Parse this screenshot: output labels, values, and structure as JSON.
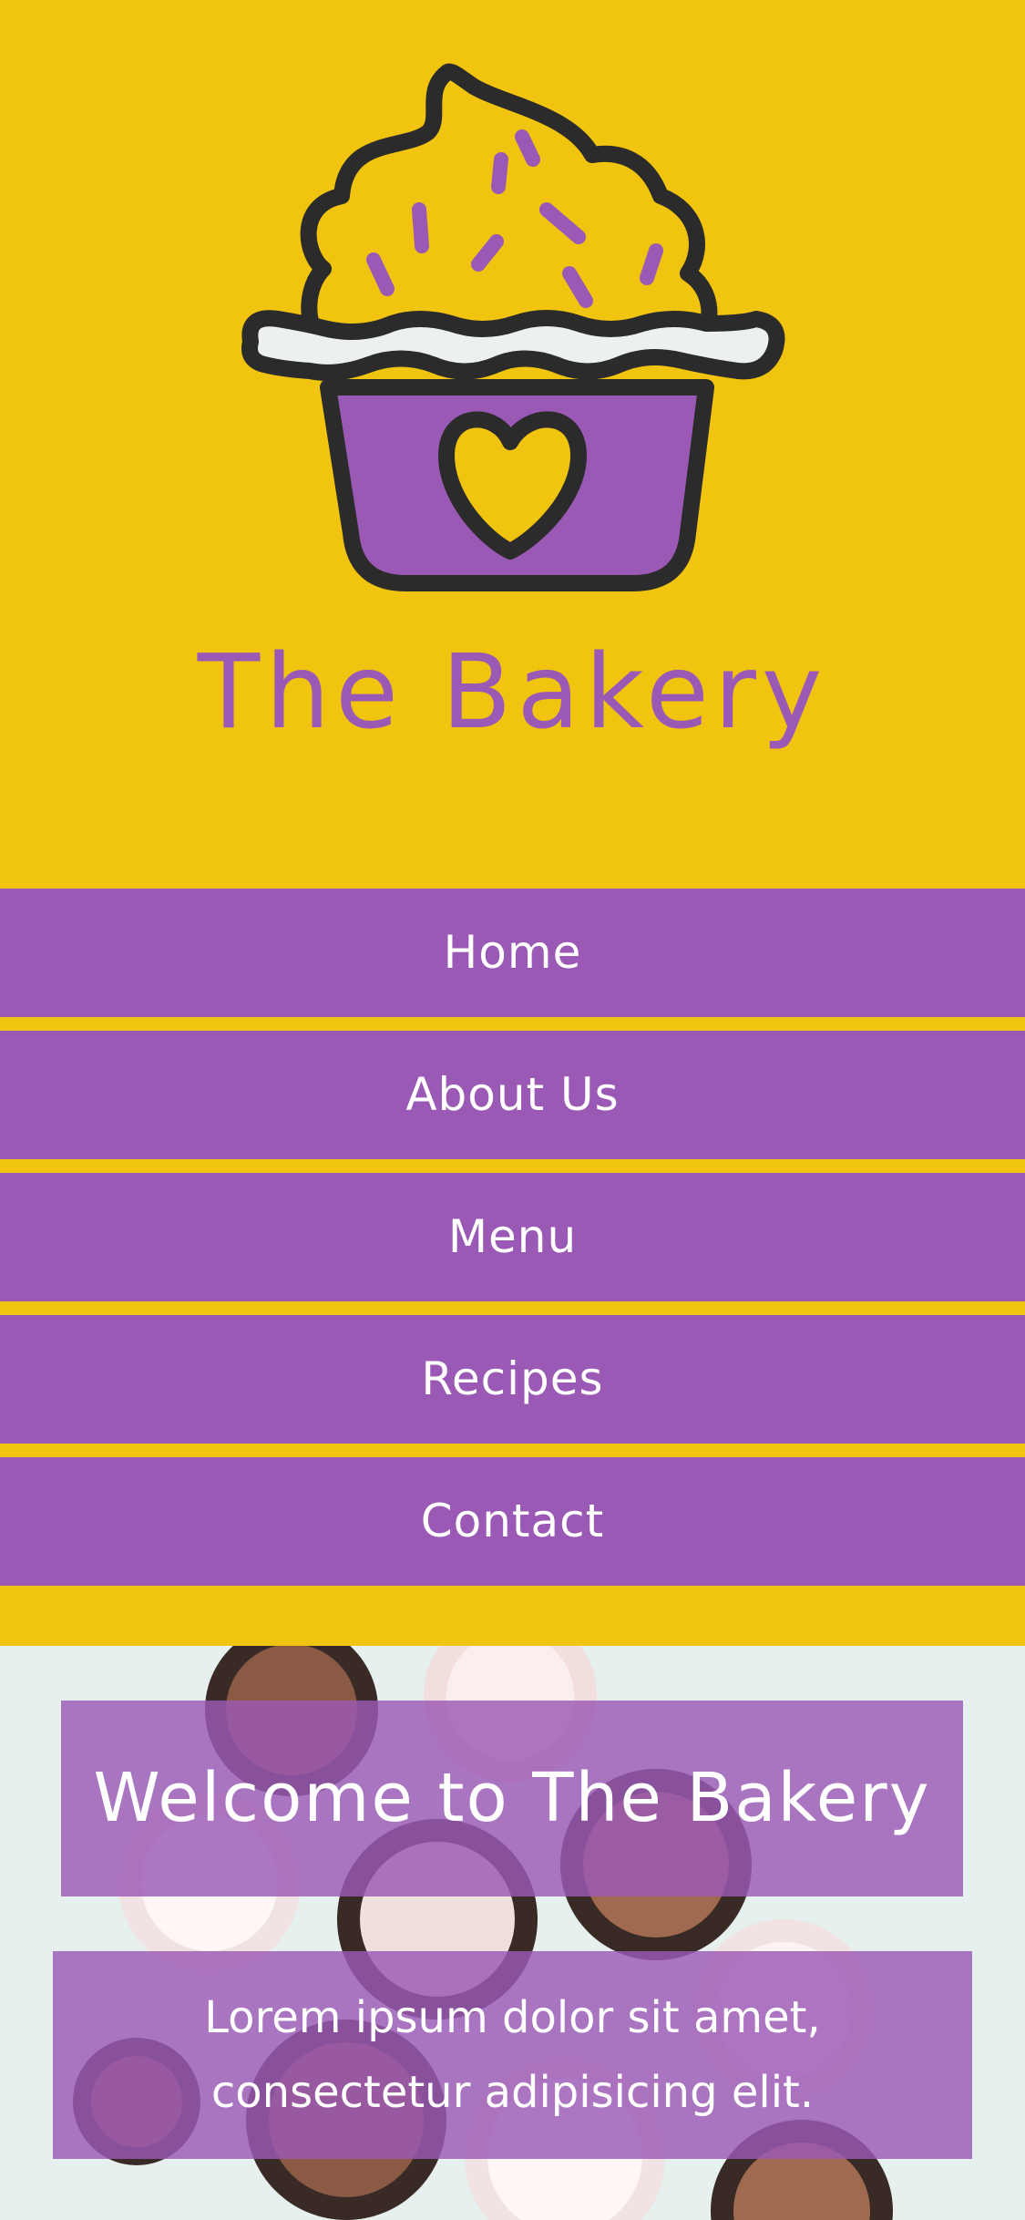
{
  "header": {
    "logo_icon": "cupcake-icon",
    "title": "The Bakery"
  },
  "nav": {
    "items": [
      {
        "label": "Home"
      },
      {
        "label": "About Us"
      },
      {
        "label": "Menu"
      },
      {
        "label": "Recipes"
      },
      {
        "label": "Contact"
      }
    ]
  },
  "hero": {
    "background_image": "cupcakes-photo",
    "welcome_heading": "Welcome to The Bakery",
    "lorem_line_1": "Lorem ipsum dolor sit amet,",
    "lorem_line_2": "consectetur adipisicing elit."
  },
  "colors": {
    "brand_yellow": "#f1c40f",
    "brand_purple": "#9b59b6",
    "outline_dark": "#2b2b2b",
    "white": "#ffffff"
  }
}
